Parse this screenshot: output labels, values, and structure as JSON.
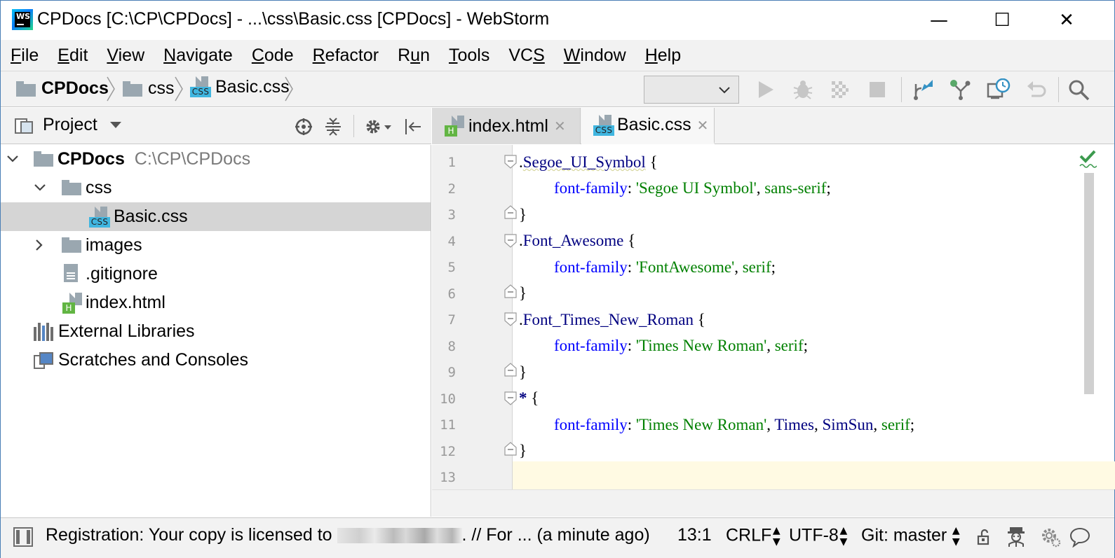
{
  "window": {
    "title": "CPDocs [C:\\CP\\CPDocs] - ...\\css\\Basic.css [CPDocs] - WebStorm",
    "app_icon_text": "WS",
    "controls": {
      "minimize": "—",
      "maximize": "☐",
      "close": "✕"
    }
  },
  "menu": [
    {
      "pre": "",
      "mn": "F",
      "post": "ile"
    },
    {
      "pre": "",
      "mn": "E",
      "post": "dit"
    },
    {
      "pre": "",
      "mn": "V",
      "post": "iew"
    },
    {
      "pre": "",
      "mn": "N",
      "post": "avigate"
    },
    {
      "pre": "",
      "mn": "C",
      "post": "ode"
    },
    {
      "pre": "",
      "mn": "R",
      "post": "efactor"
    },
    {
      "pre": "R",
      "mn": "u",
      "post": "n"
    },
    {
      "pre": "",
      "mn": "T",
      "post": "ools"
    },
    {
      "pre": "VC",
      "mn": "S",
      "post": ""
    },
    {
      "pre": "",
      "mn": "W",
      "post": "indow"
    },
    {
      "pre": "",
      "mn": "H",
      "post": "elp"
    }
  ],
  "breadcrumb": {
    "project": "CPDocs",
    "folder": "css",
    "file": "Basic.css",
    "css_badge": "CSS"
  },
  "toolbar": {
    "run_config_value": "",
    "icons": [
      "run-icon",
      "debug-icon",
      "coverage-icon",
      "stop-icon",
      "vcs-update-icon",
      "vcs-commit-icon",
      "vcs-history-icon",
      "revert-icon",
      "search-icon"
    ]
  },
  "project_panel": {
    "title": "Project",
    "tree": {
      "root_name": "CPDocs",
      "root_path": "C:\\CP\\CPDocs",
      "css_folder": "css",
      "basic_css": "Basic.css",
      "images": "images",
      "gitignore": ".gitignore",
      "index_html": "index.html",
      "external_libraries": "External Libraries",
      "scratches": "Scratches and Consoles"
    }
  },
  "tabs": [
    {
      "label": "index.html",
      "badge": "H",
      "active": false
    },
    {
      "label": "Basic.css",
      "badge": "CSS",
      "active": true
    }
  ],
  "editor": {
    "line_numbers": [
      "1",
      "2",
      "3",
      "4",
      "5",
      "6",
      "7",
      "8",
      "9",
      "10",
      "11",
      "12",
      "13"
    ],
    "code": {
      "l1_dot": ".",
      "l1_sel": "Segoe_UI_Symbol",
      "l1_brace": " {",
      "l2_prop": "font-family",
      "l2_colon": ": ",
      "l2_str": "'Segoe UI Symbol'",
      "l2_comma": ", ",
      "l2_kw": "sans-serif",
      "l2_semi": ";",
      "l3": "}",
      "l4_dot": ".",
      "l4_sel": "Font_Awesome",
      "l4_brace": " {",
      "l5_prop": "font-family",
      "l5_colon": ": ",
      "l5_str": "'FontAwesome'",
      "l5_comma": ", ",
      "l5_kw": "serif",
      "l5_semi": ";",
      "l6": "}",
      "l7_dot": ".",
      "l7_sel": "Font_Times_New_Roman",
      "l7_brace": " {",
      "l8_prop": "font-family",
      "l8_colon": ": ",
      "l8_str": "'Times New Roman'",
      "l8_comma": ", ",
      "l8_kw": "serif",
      "l8_semi": ";",
      "l9": "}",
      "l10_sel": "*",
      "l10_brace": " {",
      "l11_prop": "font-family",
      "l11_colon": ": ",
      "l11_str": "'Times New Roman'",
      "l11_c1": ", ",
      "l11_v1": "Times",
      "l11_c2": ", ",
      "l11_v2": "SimSun",
      "l11_c3": ", ",
      "l11_kw": "serif",
      "l11_semi": ";",
      "l12": "}"
    }
  },
  "status": {
    "message_prefix": "Registration: Your copy is licensed to ",
    "message_suffix": ". // For ... (a minute ago)",
    "position": "13:1",
    "line_separator": "CRLF",
    "encoding": "UTF-8",
    "git_branch": "Git: master",
    "toggle_glyph": "▲▼"
  },
  "colors": {
    "selector": "#000080",
    "property": "#0000ff",
    "string": "#008000",
    "current_line": "#fffae3",
    "selection": "#d5d5d5"
  }
}
